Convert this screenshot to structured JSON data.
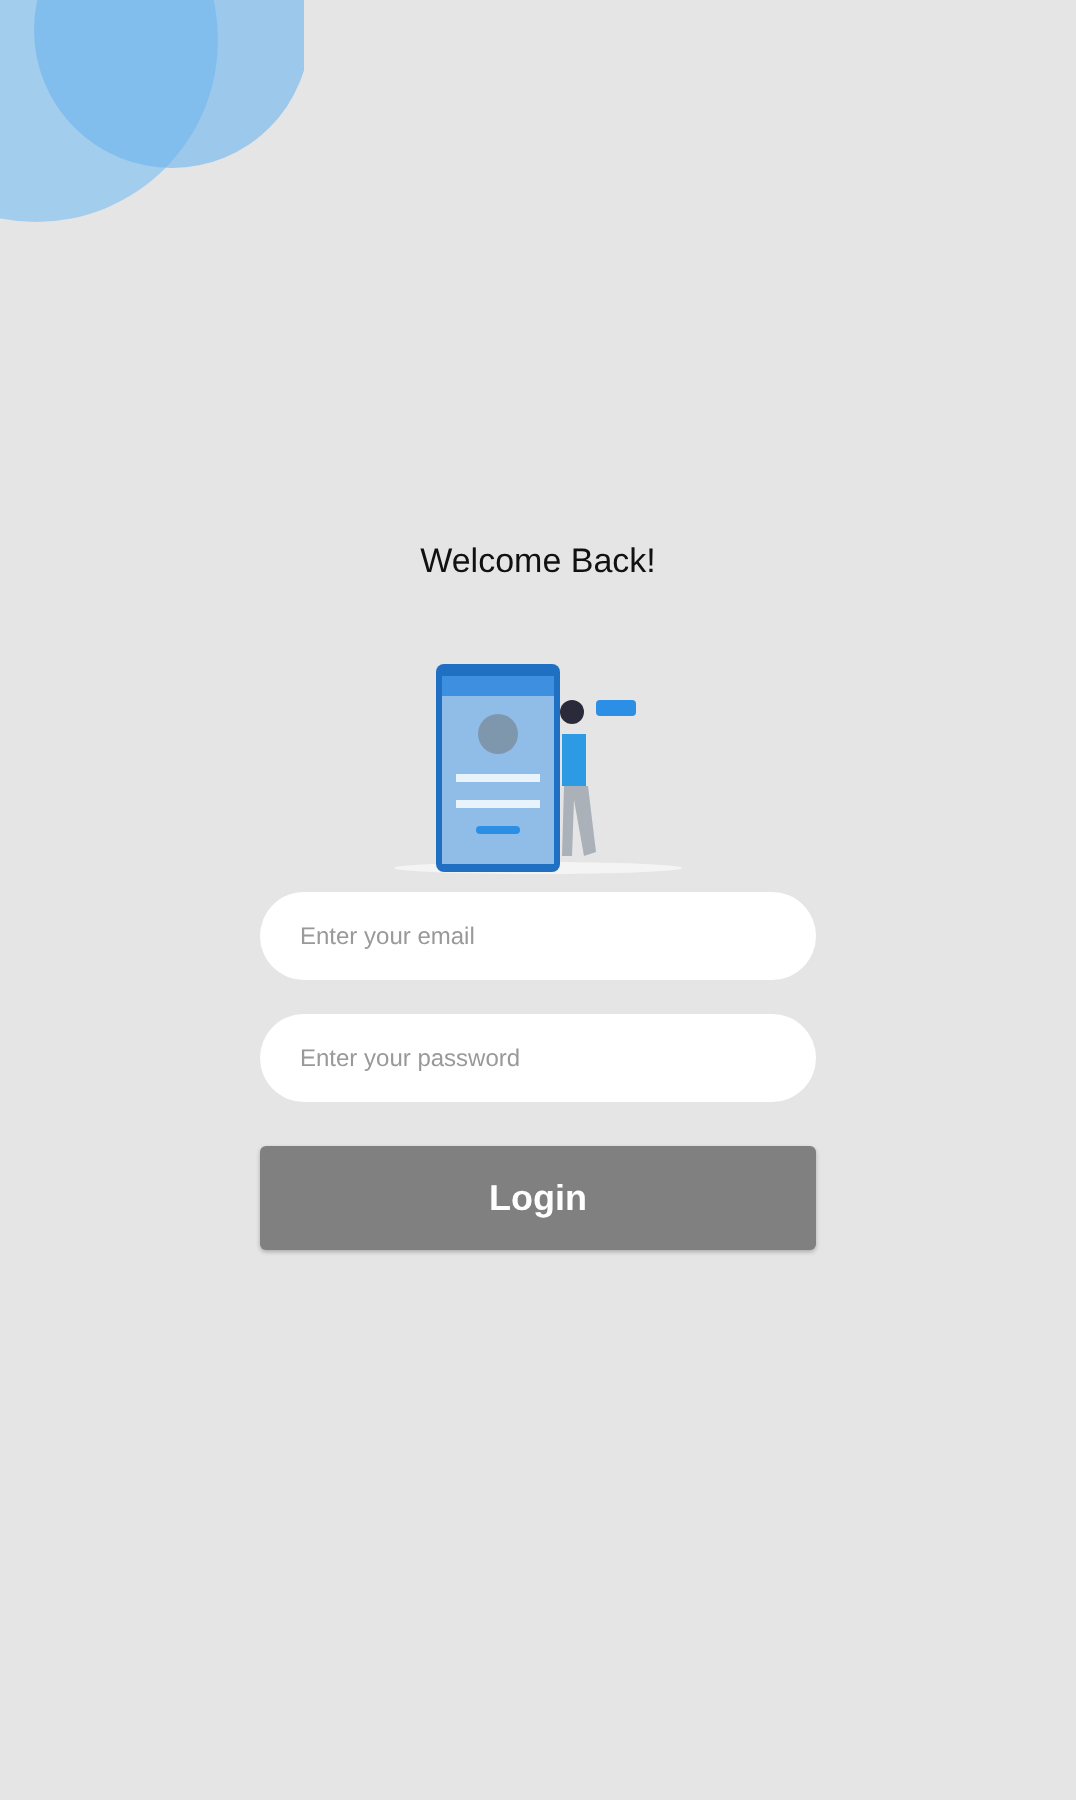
{
  "title": "Welcome Back!",
  "email_field": {
    "placeholder": "Enter your email"
  },
  "password_field": {
    "placeholder": "Enter your password"
  },
  "login_button": {
    "label": "Login"
  }
}
